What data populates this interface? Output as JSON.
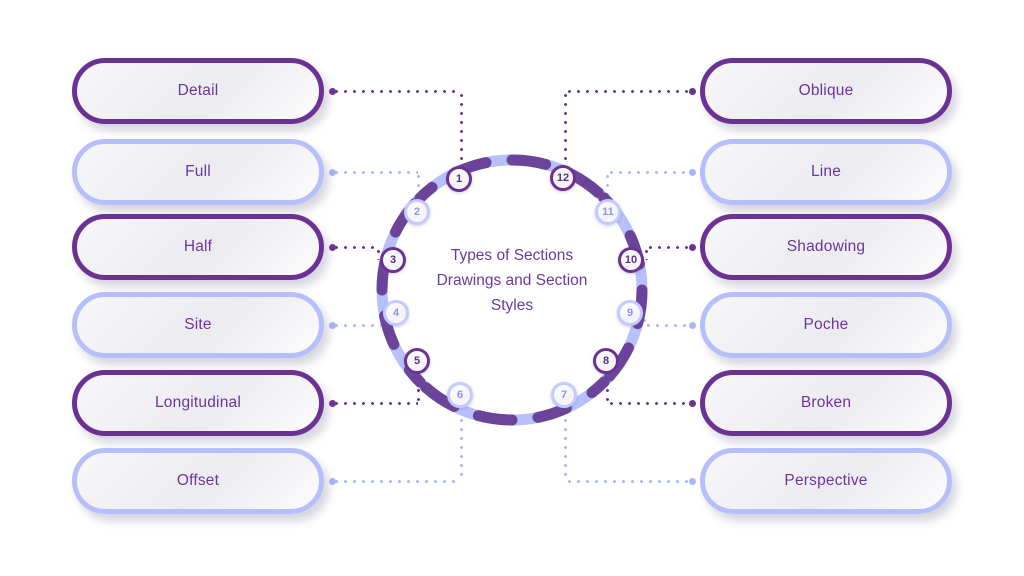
{
  "diagram": {
    "center_title_lines": [
      "Types of Sections",
      "Drawings and Section",
      "Styles"
    ],
    "colors": {
      "dark_purple": "#6b3294",
      "light_periwinkle": "#b7bffa",
      "label_text": "#6e359c",
      "center_text": "#6a3b9e",
      "background": "#ffffff"
    }
  },
  "left_items": [
    {
      "number": "1",
      "label": "Detail",
      "tone": "dark"
    },
    {
      "number": "2",
      "label": "Full",
      "tone": "light"
    },
    {
      "number": "3",
      "label": "Half",
      "tone": "dark"
    },
    {
      "number": "4",
      "label": "Site",
      "tone": "light"
    },
    {
      "number": "5",
      "label": "Longitudinal",
      "tone": "dark"
    },
    {
      "number": "6",
      "label": "Offset",
      "tone": "light"
    }
  ],
  "right_items": [
    {
      "number": "12",
      "label": "Oblique",
      "tone": "dark"
    },
    {
      "number": "11",
      "label": "Line",
      "tone": "light"
    },
    {
      "number": "10",
      "label": "Shadowing",
      "tone": "dark"
    },
    {
      "number": "9",
      "label": "Poche",
      "tone": "light"
    },
    {
      "number": "8",
      "label": "Broken",
      "tone": "dark"
    },
    {
      "number": "7",
      "label": "Perspective",
      "tone": "light"
    }
  ],
  "badges": [
    {
      "number": "1",
      "tone": "dark"
    },
    {
      "number": "2",
      "tone": "light"
    },
    {
      "number": "3",
      "tone": "dark"
    },
    {
      "number": "4",
      "tone": "light"
    },
    {
      "number": "5",
      "tone": "dark"
    },
    {
      "number": "6",
      "tone": "light"
    },
    {
      "number": "7",
      "tone": "light"
    },
    {
      "number": "8",
      "tone": "dark"
    },
    {
      "number": "9",
      "tone": "light"
    },
    {
      "number": "10",
      "tone": "dark"
    },
    {
      "number": "11",
      "tone": "light"
    },
    {
      "number": "12",
      "tone": "dark"
    }
  ]
}
